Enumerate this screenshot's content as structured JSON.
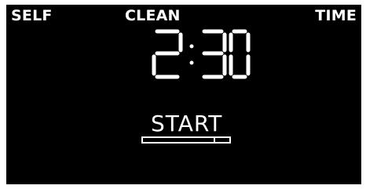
{
  "header": {
    "left": "SELF",
    "center": "CLEAN",
    "right": "TIME"
  },
  "display": {
    "time": "2:30",
    "hours": "2",
    "minutes": "30"
  },
  "action": {
    "label": "START",
    "progress_fraction": 0.82
  },
  "colors": {
    "panel": "#000000",
    "text": "#ffffff",
    "outer": "#ffffff"
  }
}
